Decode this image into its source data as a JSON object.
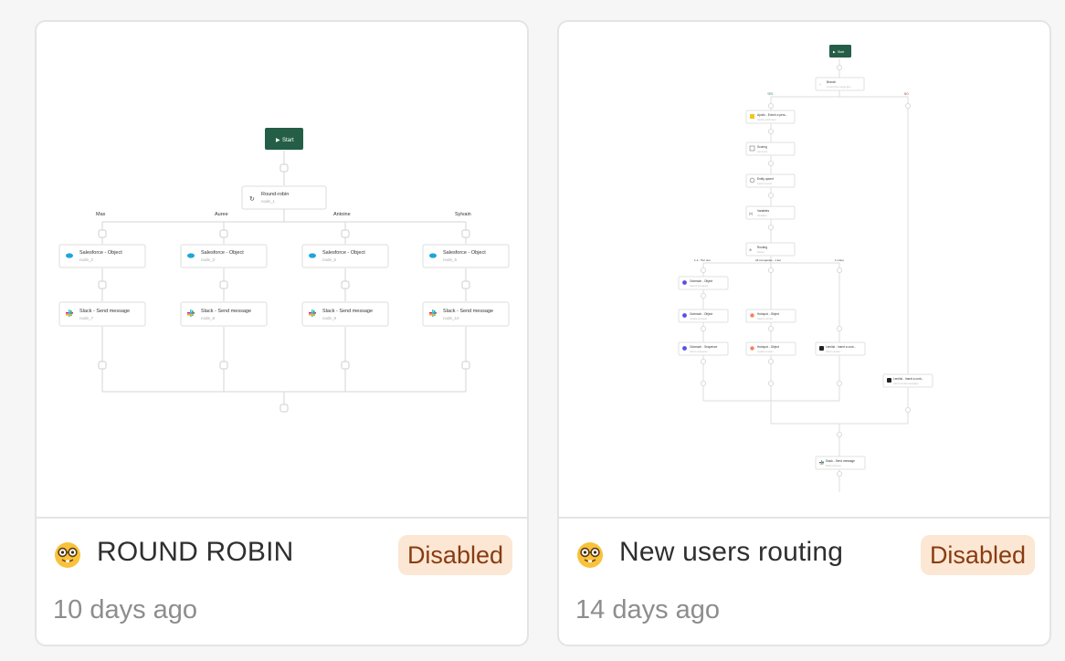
{
  "cards": [
    {
      "name": "ROUND ROBIN",
      "status": "Disabled",
      "updated": "10 days ago",
      "preview": {
        "start_label": "Start",
        "router": {
          "title": "Round-robin",
          "sub": "node_1"
        },
        "branches": [
          "Max",
          "Auree",
          "Antoine",
          "Sylvain"
        ],
        "salesforce_nodes": [
          {
            "title": "Salesforce - Object",
            "sub": "node_2"
          },
          {
            "title": "Salesforce - Object",
            "sub": "node_3"
          },
          {
            "title": "Salesforce - Object",
            "sub": "node_5"
          },
          {
            "title": "Salesforce - Object",
            "sub": "node_6"
          }
        ],
        "slack_nodes": [
          {
            "title": "Slack - Send message",
            "sub": "node_7"
          },
          {
            "title": "Slack - Send message",
            "sub": "node_8"
          },
          {
            "title": "Slack - Send message",
            "sub": "node_9"
          },
          {
            "title": "Slack - Send message",
            "sub": "node_10"
          }
        ]
      }
    },
    {
      "name": "New users routing",
      "status": "Disabled",
      "updated": "14 days ago",
      "preview": {
        "start_label": "Start",
        "branch_node": {
          "title": "Branch",
          "sub": "Is user from target geo..."
        },
        "branch_labels": [
          "YES",
          "NO"
        ],
        "main_nodes": [
          {
            "title": "Apollo - Enrich a pers...",
            "sub": "Apollo enrichment"
          },
          {
            "title": "Scoring",
            "sub": "Get score"
          },
          {
            "title": "Entity upsert",
            "sub": "Upsert record"
          },
          {
            "title": "Variables",
            "sub": "Variables"
          },
          {
            "title": "Routing",
            "sub": "Router"
          }
        ],
        "routing_labels": [
          "1-1 - Tier one",
          "All companies - 1 tier",
          "1 many"
        ],
        "outreach_nodes": [
          {
            "title": "Outreach - Object",
            "sub": "Search prospects"
          },
          {
            "title": "Outreach - Object",
            "sub": "Update prospect"
          },
          {
            "title": "Outreach - Sequence",
            "sub": "Add to sequence"
          }
        ],
        "hubspot_nodes": [
          {
            "title": "Hubspot - Object",
            "sub": "Search contact"
          },
          {
            "title": "Hubspot - Object",
            "sub": "Update contact"
          }
        ],
        "lemlist_nodes": [
          {
            "title": "Lemlist - Insert a cont...",
            "sub": "Add to lemlist"
          },
          {
            "title": "Lemlist - Insert a cont...",
            "sub": "Add to lemlist campaign"
          }
        ],
        "final_node": {
          "title": "Slack - Send message",
          "sub": "Notify channel"
        }
      }
    }
  ]
}
